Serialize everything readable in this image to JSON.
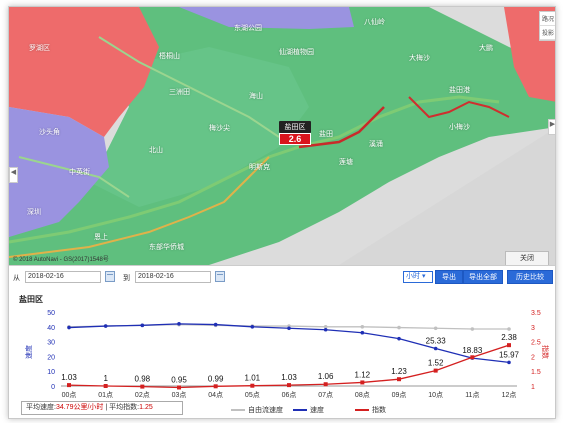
{
  "map": {
    "district_name": "盐田区",
    "district_value": "2.6",
    "copyright": "© 2018 AutoNavi - GS(2017)1548号",
    "close_label": "关闭",
    "tools": [
      "路况",
      "投影"
    ],
    "place_labels": [
      "梧桐山",
      "东湖公园",
      "仙湖植物园",
      "大梅沙",
      "盐田港",
      "沙头角",
      "中英街",
      "海山",
      "明斯克",
      "溪涌",
      "大鹏",
      "罗湖区",
      "莲塘",
      "梅沙尖",
      "八仙岭",
      "北山",
      "三洲田",
      "小梅沙",
      "恩上",
      "盐田",
      "东部华侨城",
      "深圳"
    ]
  },
  "controls": {
    "from_label": "从",
    "to_label": "到",
    "from_date": "2018-02-16",
    "to_date": "2018-02-16",
    "unit": "小时",
    "export_label": "导出",
    "export_all_label": "导出全部",
    "history_label": "历史比较"
  },
  "chart_title": "盐田区",
  "stats": {
    "avg_speed_label": "平均速度:",
    "avg_speed_value": "34.79公里/小时",
    "avg_index_label": "平均指数:",
    "avg_index_value": "1.25"
  },
  "chart_data": {
    "type": "line",
    "categories": [
      "00点",
      "01点",
      "02点",
      "03点",
      "04点",
      "05点",
      "06点",
      "07点",
      "08点",
      "09点",
      "10点",
      "11点",
      "12点"
    ],
    "ylabel_left": "速度",
    "ylabel_right": "指数",
    "ylim_left": [
      0,
      50
    ],
    "ylim_right": [
      1,
      3.5
    ],
    "left_ticks": [
      0,
      10,
      20,
      30,
      40,
      50
    ],
    "right_ticks": [
      "1",
      "1.5",
      "2",
      "2.5",
      "3",
      "3.5"
    ],
    "series": [
      {
        "name": "自由流速度",
        "axis": "left",
        "color": "#c0c0c0",
        "values": [
          40,
          40.5,
          41,
          41.5,
          41,
          40.5,
          40.5,
          40,
          40,
          39.5,
          39,
          38.5,
          38.5
        ]
      },
      {
        "name": "速度",
        "axis": "left",
        "color": "#1f2fb5",
        "values": [
          39.5,
          40.5,
          41,
          42,
          41.5,
          40,
          39,
          38,
          36,
          32,
          25.33,
          18.83,
          15.97
        ]
      },
      {
        "name": "指数",
        "axis": "right",
        "color": "#d42020",
        "values": [
          1.03,
          1,
          0.98,
          0.95,
          0.99,
          1.01,
          1.03,
          1.06,
          1.12,
          1.23,
          1.52,
          1.97,
          2.38
        ]
      }
    ],
    "data_labels": [
      "1.03",
      "1",
      "0.98",
      "0.95",
      "0.99",
      "1.01",
      "1.03",
      "1.06",
      "1.12",
      "1.23",
      "1.52",
      "2.38"
    ],
    "speed_labels": [
      "25.33",
      "18.83",
      "15.97"
    ],
    "legend_position": "bottom",
    "grid": false
  }
}
